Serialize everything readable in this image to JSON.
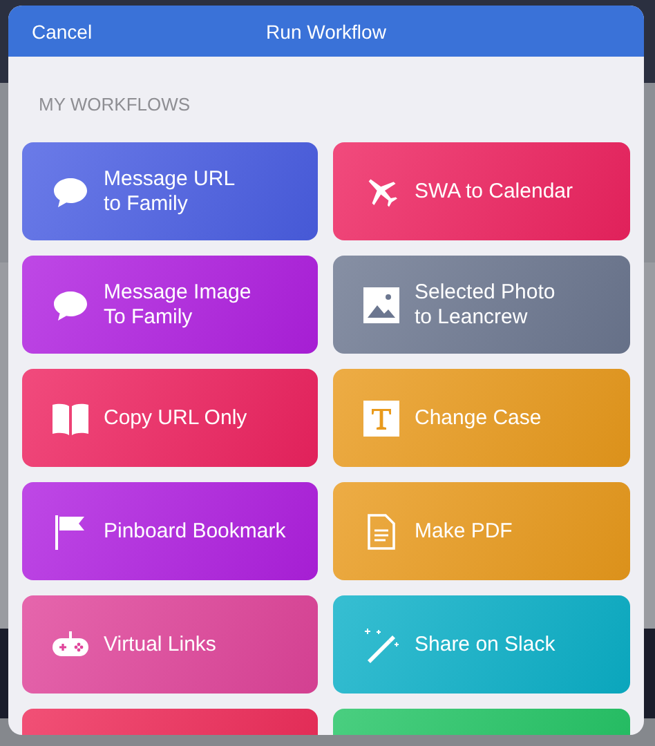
{
  "header": {
    "cancel": "Cancel",
    "title": "Run Workflow"
  },
  "section": "MY WORKFLOWS",
  "workflows": [
    {
      "kind": "message",
      "lines": [
        "Message URL",
        "to Family"
      ],
      "color": "#4a5ee3"
    },
    {
      "kind": "plane",
      "lines": [
        "SWA to Calendar"
      ],
      "color": "#ee2360"
    },
    {
      "kind": "message",
      "lines": [
        "Message Image",
        "To Family"
      ],
      "color": "#b020e0"
    },
    {
      "kind": "image",
      "lines": [
        "Selected Photo",
        "to Leancrew"
      ],
      "color": "#6c7790"
    },
    {
      "kind": "book",
      "lines": [
        "Copy URL Only"
      ],
      "color": "#ee2360"
    },
    {
      "kind": "text",
      "lines": [
        "Change Case"
      ],
      "color": "#e99a1c"
    },
    {
      "kind": "flag",
      "lines": [
        "Pinboard Bookmark"
      ],
      "color": "#b020e0"
    },
    {
      "kind": "document",
      "lines": [
        "Make PDF"
      ],
      "color": "#e99a1c"
    },
    {
      "kind": "gamepad",
      "lines": [
        "Virtual Links"
      ],
      "color": "#e0449a"
    },
    {
      "kind": "wand",
      "lines": [
        "Share on Slack"
      ],
      "color": "#0bb0c8"
    },
    {
      "kind": "blank",
      "color": "#ee2a58"
    },
    {
      "kind": "blank",
      "color": "#22c464"
    }
  ]
}
